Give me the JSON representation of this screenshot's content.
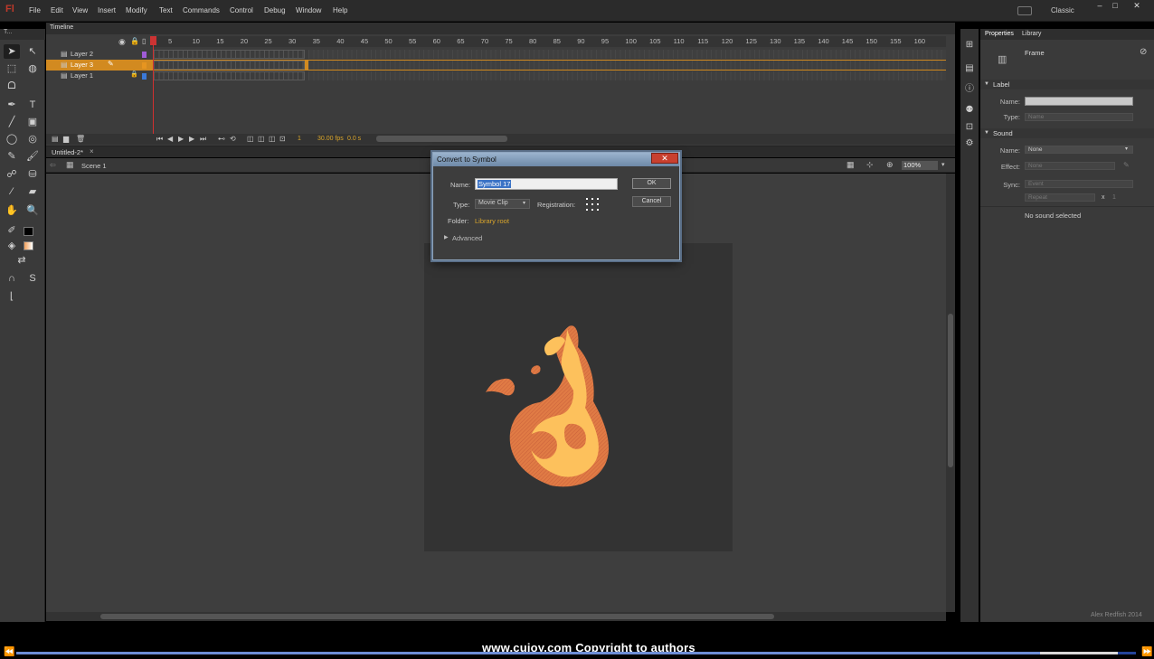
{
  "app": {
    "logo": "Fl",
    "menu": [
      "File",
      "Edit",
      "View",
      "Insert",
      "Modify",
      "Text",
      "Commands",
      "Control",
      "Debug",
      "Window",
      "Help"
    ],
    "workspace": "Classic",
    "window_buttons": [
      "–",
      "□",
      "✕"
    ]
  },
  "tools": {
    "header": "T..."
  },
  "timeline": {
    "tab": "Timeline",
    "ruler": [
      "1",
      "5",
      "10",
      "15",
      "20",
      "25",
      "30",
      "35",
      "40",
      "45",
      "50",
      "55",
      "60",
      "65",
      "70",
      "75",
      "80",
      "85",
      "90",
      "95",
      "100",
      "105",
      "110",
      "115",
      "120",
      "125",
      "130",
      "135",
      "140",
      "145",
      "150",
      "155",
      "160"
    ],
    "layers": [
      {
        "name": "Layer 2",
        "color": "#a05bd6",
        "selected": false
      },
      {
        "name": "Layer 3",
        "color": "#e69520",
        "selected": true
      },
      {
        "name": "Layer 1",
        "color": "#3b79d8",
        "selected": false
      }
    ],
    "footer": {
      "frame": "1",
      "fps": "30.00 fps",
      "time": "0.0 s"
    }
  },
  "document": {
    "tab": "Untitled-2*",
    "scene": "Scene 1",
    "zoom": "100%"
  },
  "dialog": {
    "title": "Convert to Symbol",
    "name_label": "Name:",
    "name_value": "Symbol 17",
    "type_label": "Type:",
    "type_value": "Movie Clip",
    "registration_label": "Registration:",
    "folder_label": "Folder:",
    "folder_value": "Library root",
    "advanced": "Advanced",
    "ok": "OK",
    "cancel": "Cancel"
  },
  "properties": {
    "tabs": [
      "Properties",
      "Library"
    ],
    "frame_label": "Frame",
    "label_section": "Label",
    "label_name": "Name:",
    "label_type": "Type:",
    "label_type_value": "Name",
    "sound_section": "Sound",
    "sound_name": "Name:",
    "sound_name_value": "None",
    "effect": "Effect:",
    "effect_value": "None",
    "sync": "Sync:",
    "sync_value": "Event",
    "repeat_value": "Repeat",
    "repeat_x": "x",
    "repeat_count": "1",
    "no_sound": "No sound selected",
    "credit": "Alex Redfish 2014"
  },
  "player": {
    "watermark": "www.cuioy.com Copyright to authors",
    "progress": 0.914
  }
}
